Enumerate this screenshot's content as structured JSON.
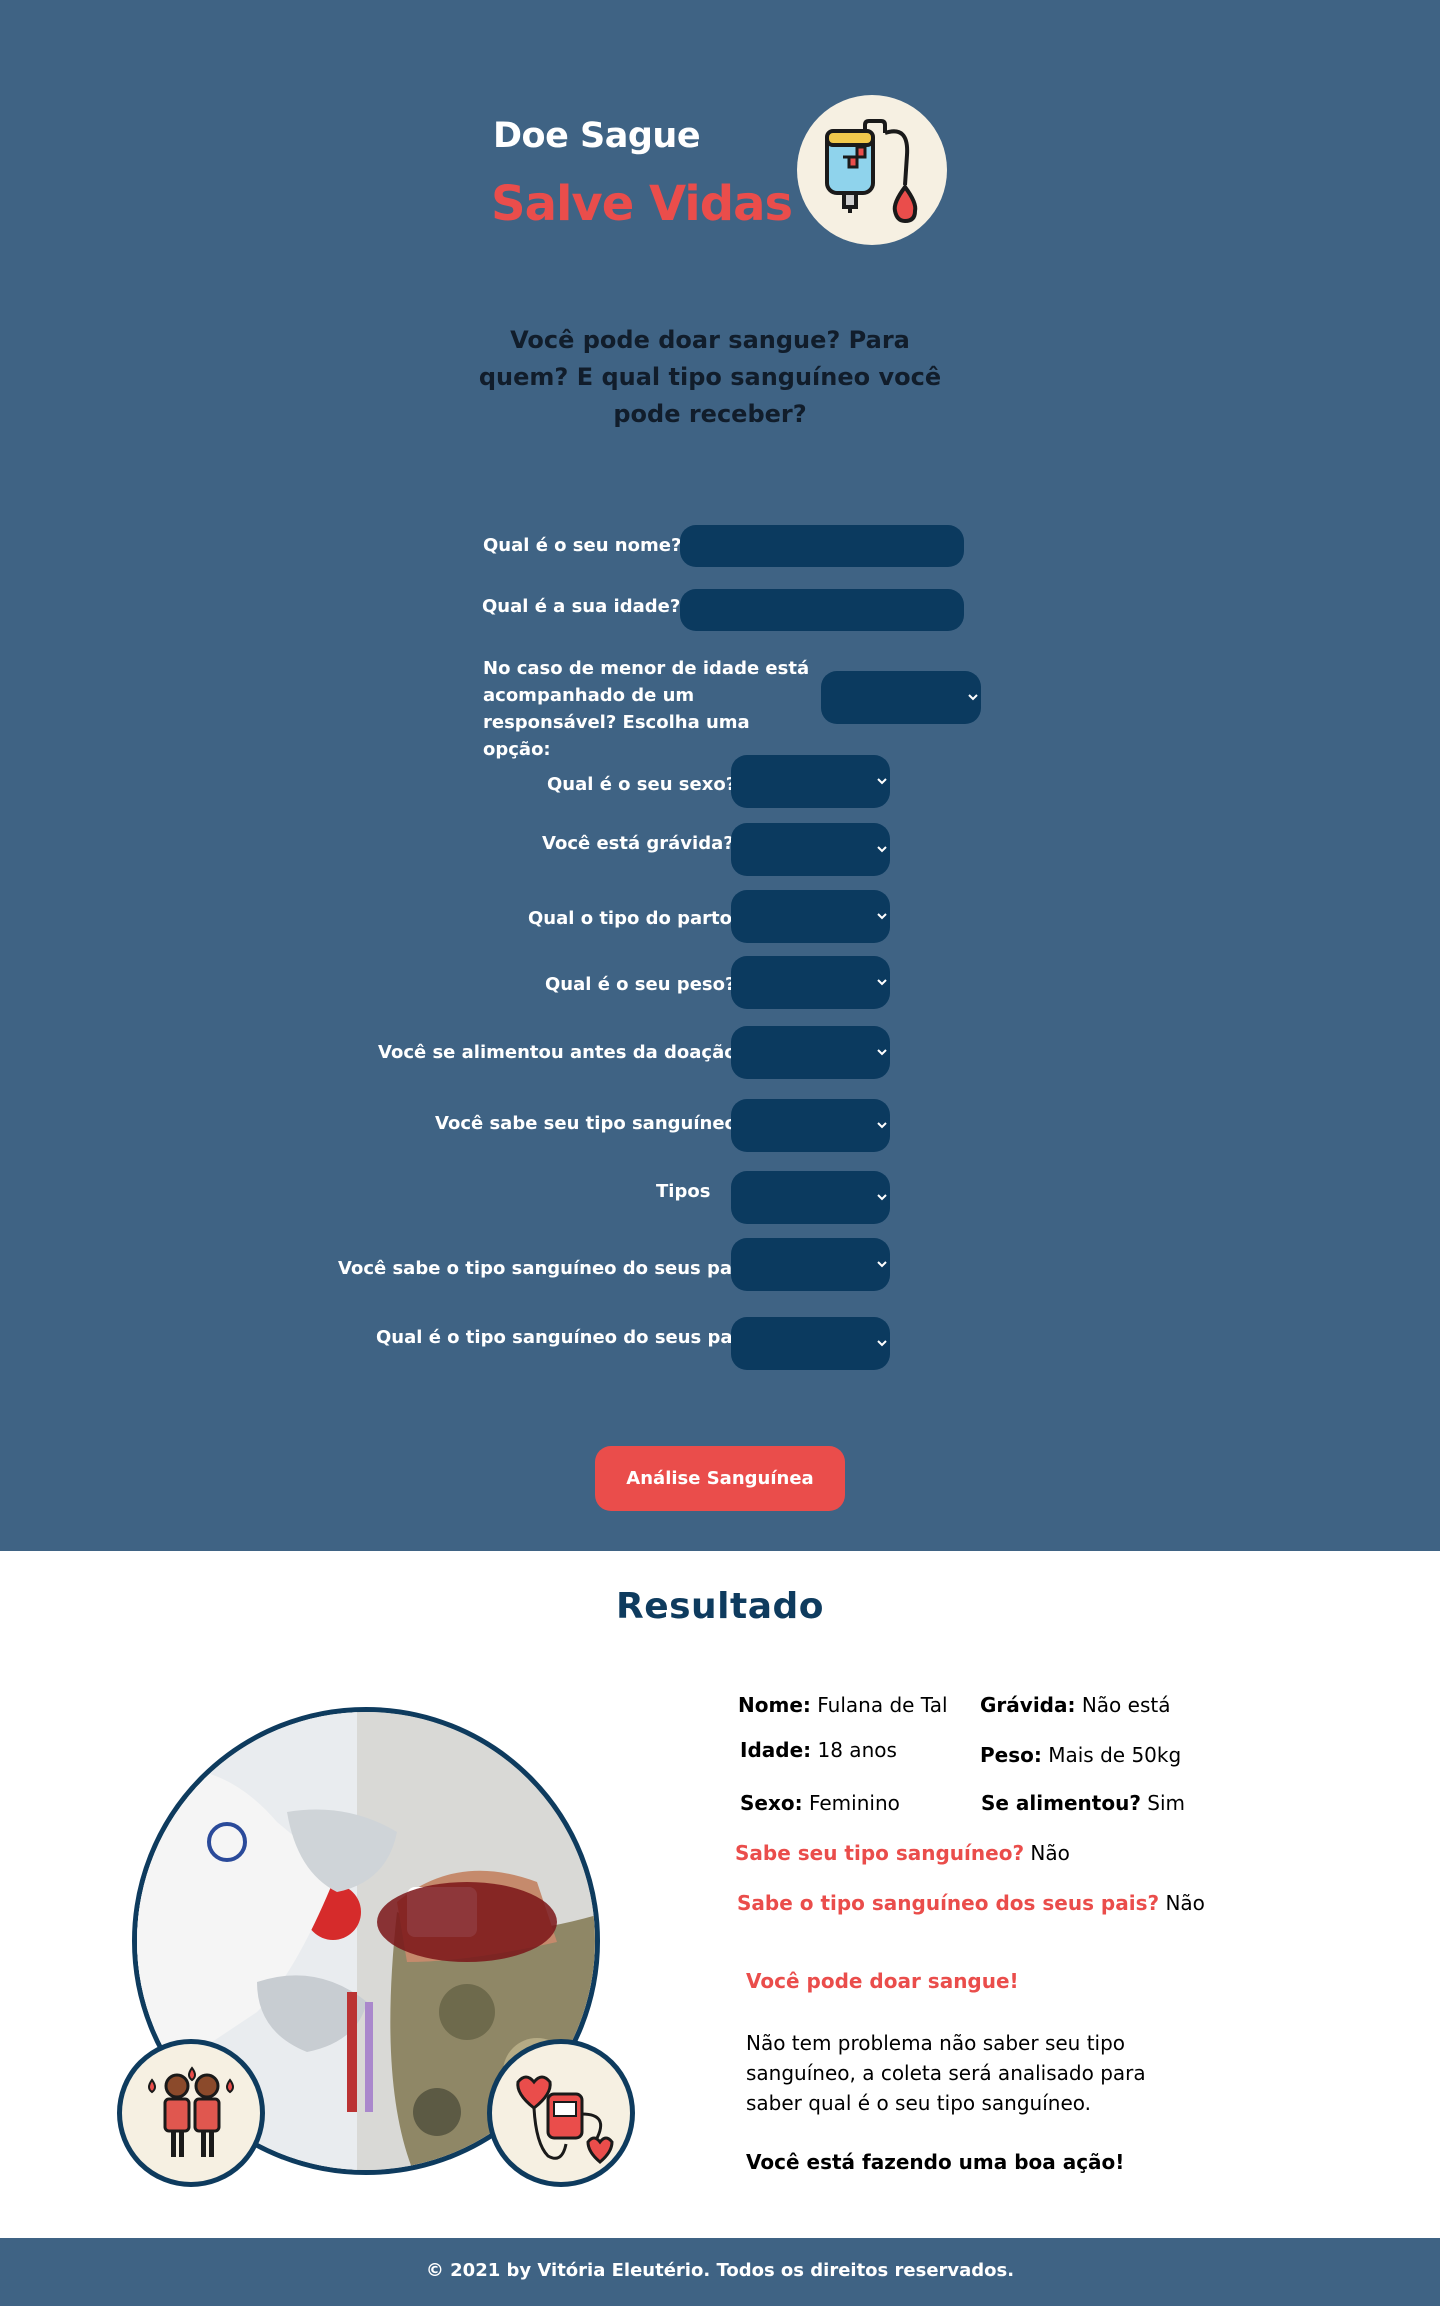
{
  "header": {
    "title_line1": "Doe Sague",
    "title_line2": "Salve Vidas",
    "logo_icon": "blood-bag-icon",
    "question": "Você pode doar sangue? Para quem? E qual tipo sanguíneo você pode receber?"
  },
  "form": {
    "name_label": "Qual é o seu nome?",
    "age_label": "Qual é a sua idade?",
    "guardian_label": "No caso de menor de idade está acompanhado de um responsável? Escolha uma opção:",
    "sex_label": "Qual é o seu sexo?",
    "pregnant_label": "Você está grávida?",
    "birth_label": "Qual o tipo do parto?",
    "weight_label": "Qual é o seu peso?",
    "fed_label": "Você se alimentou antes da doação?",
    "knows_type_label": "Você sabe seu tipo sanguíneo?",
    "types_label": "Tipos",
    "knows_parents_label": "Você sabe o tipo sanguíneo do seus pais?",
    "parents_type_label": "Qual é o tipo sanguíneo do seus pais?",
    "analyze_button": "Análise Sanguínea"
  },
  "result": {
    "title": "Resultado",
    "name_key": "Nome:",
    "name_value": "Fulana de Tal",
    "age_key": "Idade:",
    "age_value": "18 anos",
    "sex_key": "Sexo:",
    "sex_value": "Feminino",
    "pregnant_key": "Grávida:",
    "pregnant_value": "Não está",
    "weight_key": "Peso:",
    "weight_value": "Mais de 50kg",
    "fed_key": "Se alimentou?",
    "fed_value": "Sim",
    "knows_type_key": "Sabe seu tipo sanguíneo?",
    "knows_type_value": "Não",
    "knows_parents_key": "Sabe o tipo sanguíneo dos seus pais?",
    "knows_parents_value": "Não",
    "can_donate": "Você pode doar sangue!",
    "explanation": "Não tem problema não saber seu tipo sanguíneo, a coleta será analisado para saber qual é o seu tipo sanguíneo.",
    "good_action": "Você está fazendo uma boa ação!"
  },
  "footer": {
    "copyright": "© 2021 by Vitória Eleutério. Todos os direitos reservados."
  },
  "colors": {
    "background_blue": "#3f6384",
    "field_navy": "#0b3a5f",
    "accent_red": "#ea4d4b",
    "cream": "#f6f0e2",
    "title_navy": "#0e3b5e"
  }
}
